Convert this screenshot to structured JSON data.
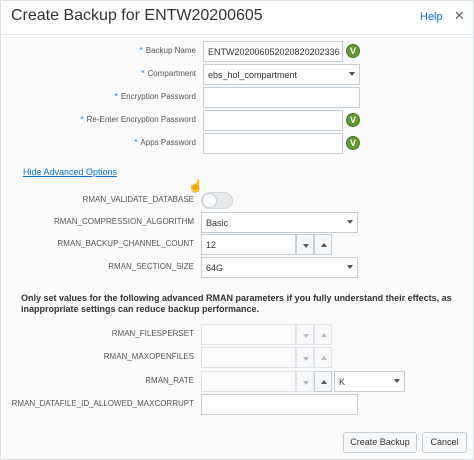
{
  "dialog": {
    "title": "Create Backup for ENTW20200605",
    "help_label": "Help",
    "close_glyph": "✕"
  },
  "form": {
    "backup_name": {
      "label": "Backup Name",
      "required": true,
      "value": "ENTW20200605202082020233​6"
    },
    "compartment": {
      "label": "Compartment",
      "required": true,
      "value": "ebs_hol_compartment"
    },
    "encryption_password": {
      "label": "Encryption Password",
      "required": true,
      "value": ""
    },
    "reenter_encryption_password": {
      "label": "Re-Enter Encryption Password",
      "required": true,
      "value": ""
    },
    "apps_password": {
      "label": "Apps Password",
      "required": true,
      "value": ""
    }
  },
  "advanced_link": "Hide Advanced Options",
  "advanced": {
    "validate_database": {
      "label": "RMAN_VALIDATE_DATABASE",
      "on": false
    },
    "compression_algorithm": {
      "label": "RMAN_COMPRESSION_ALGORITHM",
      "value": "Basic"
    },
    "backup_channel_count": {
      "label": "RMAN_BACKUP_CHANNEL_COUNT",
      "value": "12"
    },
    "section_size": {
      "label": "RMAN_SECTION_SIZE",
      "value": "64G"
    }
  },
  "warning_text": "Only set values for the following advanced RMAN parameters if you fully understand their effects, as inappropriate settings can reduce backup performance.",
  "rman_params": {
    "filesperset": {
      "label": "RMAN_FILESPERSET",
      "value": ""
    },
    "maxopenfiles": {
      "label": "RMAN_MAXOPENFILES",
      "value": ""
    },
    "rate": {
      "label": "RMAN_RATE",
      "value": "",
      "unit": "K"
    },
    "datafile_id_allowed_maxcorrupt": {
      "label": "RMAN_DATAFILE_ID_ALLOWED_MAXCORRUPT",
      "value": ""
    }
  },
  "buttons": {
    "create": "Create Backup",
    "cancel": "Cancel"
  },
  "badge_glyph": "V",
  "required_mark": "*",
  "colors": {
    "accent": "#0572ce",
    "badge": "#5f9a34"
  }
}
